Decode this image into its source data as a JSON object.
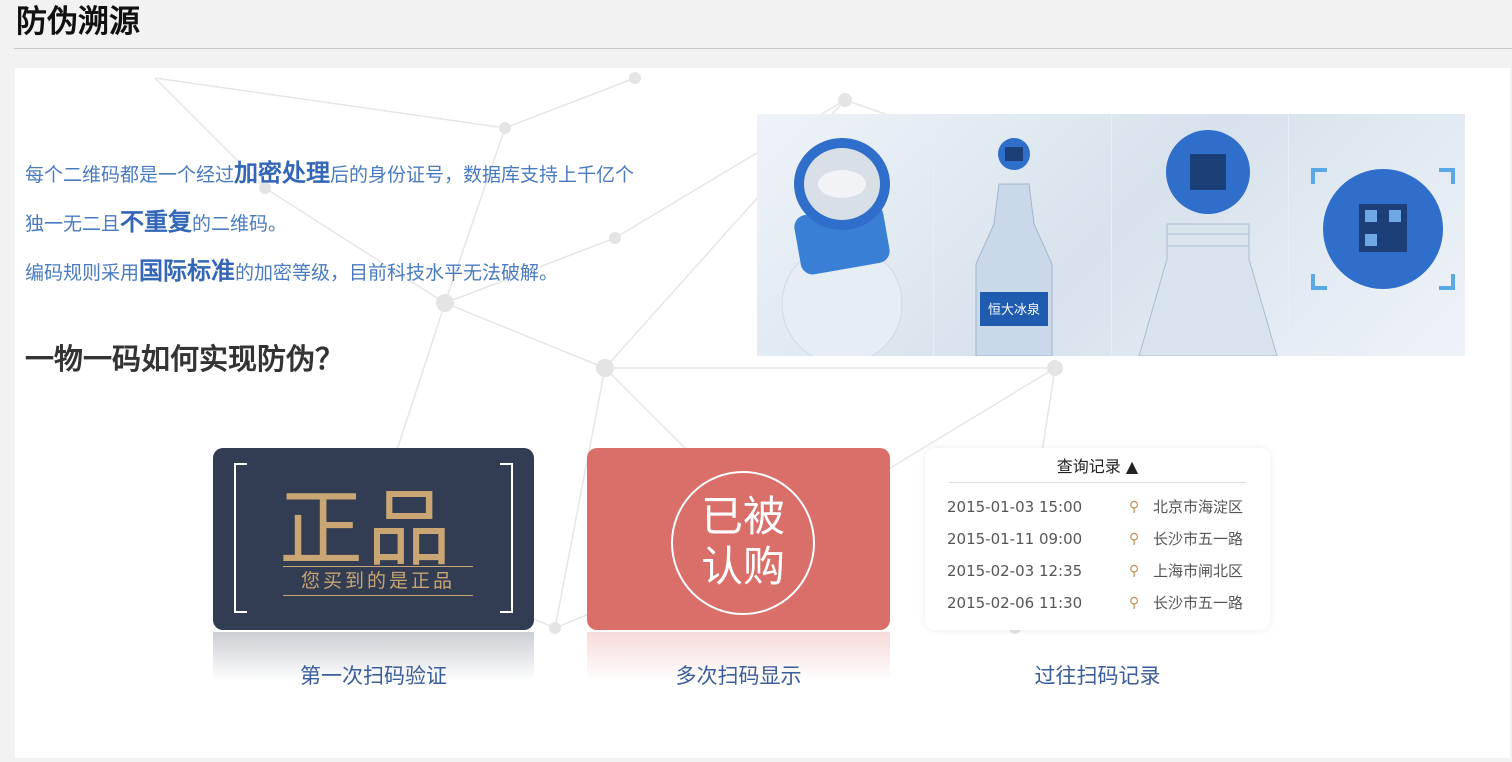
{
  "header": {
    "title": "防伪溯源"
  },
  "intro": {
    "line1_a": "每个二维码都是一个经过",
    "line1_b": "加密处理",
    "line1_c": "后的身份证号，数据库支持上千亿个",
    "line2_a": "独一无二且",
    "line2_b": "不重复",
    "line2_c": "的二维码。",
    "line3_a": "编码规则采用",
    "line3_b": "国际标准",
    "line3_c": "的加密等级，目前科技水平无法破解。"
  },
  "question": "一物一码如何实现防伪？",
  "bottle_label": "恒大冰泉",
  "cards": {
    "genuine": {
      "big": "正品",
      "sub": "您买到的是正品",
      "caption": "第一次扫码验证"
    },
    "bought": {
      "line1": "已被",
      "line2": "认购",
      "caption": "多次扫码显示"
    },
    "log": {
      "title": "查询记录 ▲",
      "rows": [
        {
          "time": "2015-01-03  15:00",
          "place": "北京市海淀区"
        },
        {
          "time": "2015-01-11  09:00",
          "place": "长沙市五一路"
        },
        {
          "time": "2015-02-03  12:35",
          "place": "上海市闸北区"
        },
        {
          "time": "2015-02-06  11:30",
          "place": "长沙市五一路"
        }
      ],
      "caption": "过往扫码记录"
    }
  },
  "icons": {
    "pin": "location-pin-icon"
  },
  "colors": {
    "accent": "#4a7bc1",
    "genuine_bg": "#323c52",
    "gold": "#c9a673",
    "bought_bg": "#da6e68"
  }
}
